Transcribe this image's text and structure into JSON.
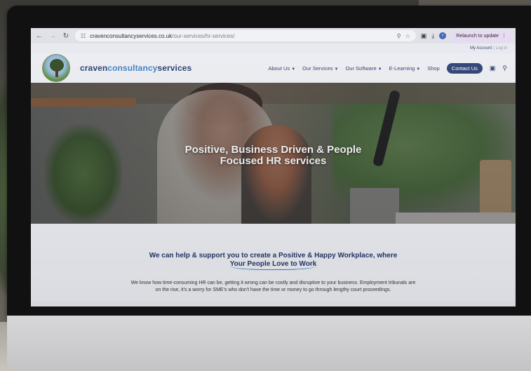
{
  "browser": {
    "url_host": "cravenconsultancyservices.co.uk",
    "url_path": "/our-services/hr-services/",
    "relaunch_label": "Relaunch to update",
    "profile_initial": "r",
    "icons": [
      "back-arrow-icon",
      "forward-arrow-icon",
      "reload-icon",
      "site-info-icon",
      "zoom-icon",
      "star-icon",
      "extensions-icon",
      "download-icon",
      "more-icon"
    ]
  },
  "topbar": {
    "my_account": "My Account",
    "separator": "|",
    "login": "Log in"
  },
  "header": {
    "brand_part1": "craven",
    "brand_part2": "consultancy",
    "brand_part3": "services",
    "nav": [
      {
        "label": "About Us"
      },
      {
        "label": "Our Services"
      },
      {
        "label": "Our Software"
      },
      {
        "label": "E-Learning"
      },
      {
        "label": "Shop"
      }
    ],
    "contact_label": "Contact Us",
    "colors": {
      "brand_dark": "#253a6e",
      "brand_light": "#3d7fc4",
      "button": "#2a3f73"
    }
  },
  "hero": {
    "title_line1": "Positive, Business Driven & People",
    "title_line2": "Focused HR services"
  },
  "content": {
    "heading_line1": "We can help & support you to create a Positive & Happy Workplace, where",
    "heading_line2": "Your People Love to Work",
    "paragraph": "We know how time-consuming HR can be, getting it wrong can be costly and disruptive to your business. Employment tribunals are on the rise, it's a worry for SME's who don't have the time or money to go through lengthy court proceedings."
  }
}
